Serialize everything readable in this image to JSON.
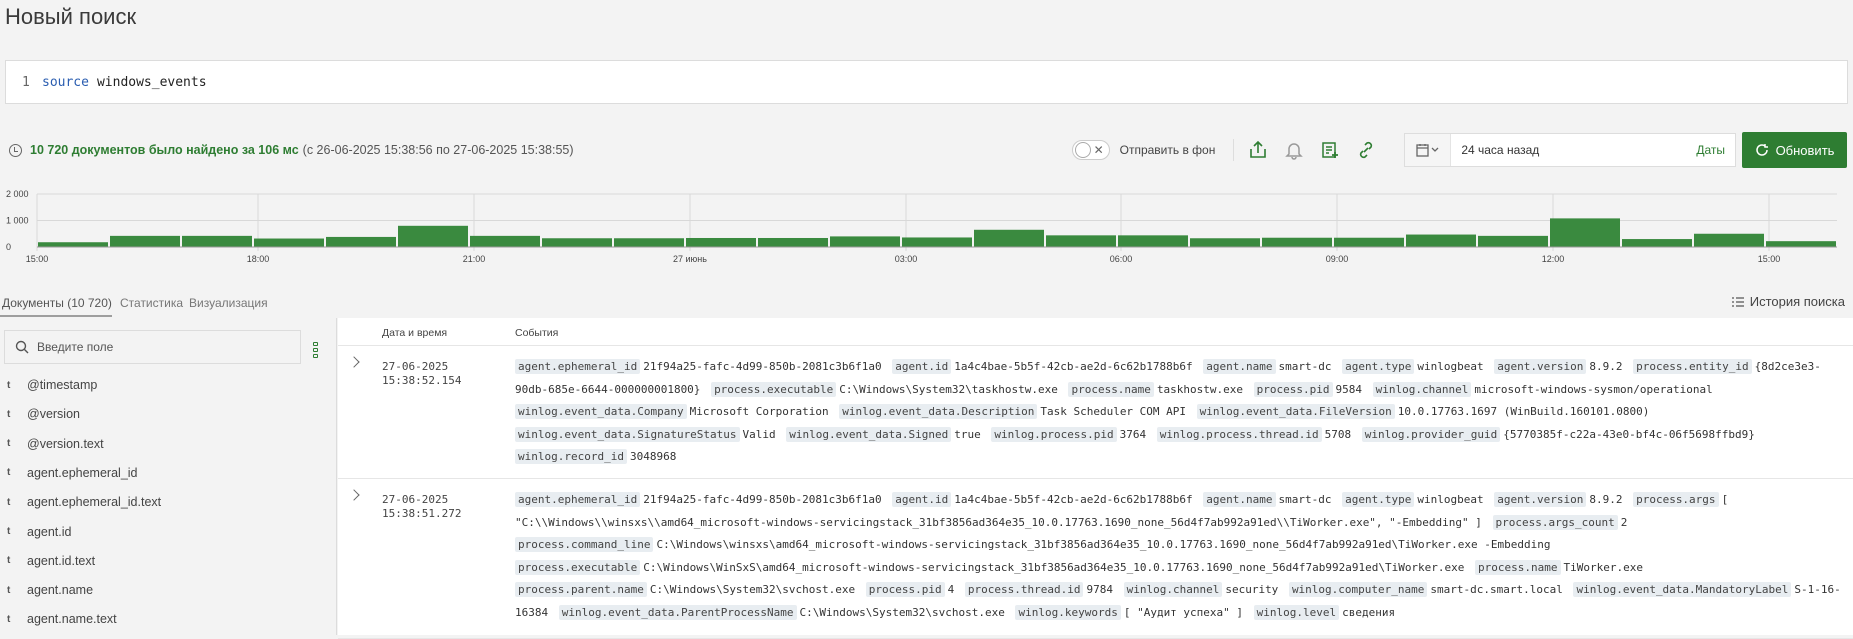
{
  "page_title": "Новый поиск",
  "editor": {
    "line": "1",
    "keyword": "source",
    "query": "windows_events"
  },
  "status": {
    "found": "10 720 документов было найдено за 106 мс",
    "range": "(с 26-06-2025 15:38:56 по 27-06-2025 15:38:55)"
  },
  "tools": {
    "background_label": "Отправить в фон",
    "toggle_x": "✕",
    "date_value": "24 часа назад",
    "dates_link": "Даты",
    "refresh_label": "Обновить"
  },
  "chart_data": {
    "type": "bar",
    "y_ticks": [
      "2 000",
      "1 000",
      "0"
    ],
    "ylim": [
      0,
      2000
    ],
    "x_ticks": [
      "15:00",
      "18:00",
      "21:00",
      "27 июнь",
      "03:00",
      "06:00",
      "09:00",
      "12:00",
      "15:00"
    ],
    "values": [
      180,
      420,
      420,
      320,
      380,
      800,
      420,
      330,
      330,
      340,
      340,
      400,
      360,
      650,
      440,
      440,
      330,
      350,
      350,
      470,
      420,
      1080,
      300,
      500,
      220
    ],
    "bar_color": "#3a8a3f",
    "grid": true
  },
  "tabs": {
    "documents": "Документы (10 720)",
    "stats": "Статистика",
    "viz": "Визуализация",
    "history": "История поиска"
  },
  "sidebar": {
    "search_placeholder": "Введите поле",
    "fields": [
      "@timestamp",
      "@version",
      "@version.text",
      "agent.ephemeral_id",
      "agent.ephemeral_id.text",
      "agent.id",
      "agent.id.text",
      "agent.name",
      "agent.name.text"
    ],
    "type_marker": "t"
  },
  "table": {
    "col_date": "Дата и время",
    "col_events": "События",
    "rows": [
      {
        "date": "27-06-2025",
        "time": "15:38:52.154",
        "pairs": [
          [
            "agent.ephemeral_id",
            "21f94a25-fafc-4d99-850b-2081c3b6f1a0"
          ],
          [
            "agent.id",
            "1a4c4bae-5b5f-42cb-ae2d-6c62b1788b6f"
          ],
          [
            "agent.name",
            "smart-dc"
          ],
          [
            "agent.type",
            "winlogbeat"
          ],
          [
            "agent.version",
            "8.9.2"
          ],
          [
            "process.entity_id",
            "{8d2ce3e3-90db-685e-6644-000000001800}"
          ],
          [
            "process.executable",
            "C:\\Windows\\System32\\taskhostw.exe"
          ],
          [
            "process.name",
            "taskhostw.exe"
          ],
          [
            "process.pid",
            "9584"
          ],
          [
            "winlog.channel",
            "microsoft-windows-sysmon/operational"
          ],
          [
            "winlog.event_data.Company",
            "Microsoft Corporation"
          ],
          [
            "winlog.event_data.Description",
            "Task Scheduler COM API"
          ],
          [
            "winlog.event_data.FileVersion",
            "10.0.17763.1697 (WinBuild.160101.0800)"
          ],
          [
            "winlog.event_data.SignatureStatus",
            "Valid"
          ],
          [
            "winlog.event_data.Signed",
            "true"
          ],
          [
            "winlog.process.pid",
            "3764"
          ],
          [
            "winlog.process.thread.id",
            "5708"
          ],
          [
            "winlog.provider_guid",
            "{5770385f-c22a-43e0-bf4c-06f5698ffbd9}"
          ],
          [
            "winlog.record_id",
            "3048968"
          ]
        ]
      },
      {
        "date": "27-06-2025",
        "time": "15:38:51.272",
        "pairs": [
          [
            "agent.ephemeral_id",
            "21f94a25-fafc-4d99-850b-2081c3b6f1a0"
          ],
          [
            "agent.id",
            "1a4c4bae-5b5f-42cb-ae2d-6c62b1788b6f"
          ],
          [
            "agent.name",
            "smart-dc"
          ],
          [
            "agent.type",
            "winlogbeat"
          ],
          [
            "agent.version",
            "8.9.2"
          ],
          [
            "process.args",
            "[ \"C:\\\\Windows\\\\winsxs\\\\amd64_microsoft-windows-servicingstack_31bf3856ad364e35_10.0.17763.1690_none_56d4f7ab992a91ed\\\\TiWorker.exe\", \"-Embedding\" ]"
          ],
          [
            "process.args_count",
            "2"
          ],
          [
            "process.command_line",
            "C:\\Windows\\winsxs\\amd64_microsoft-windows-servicingstack_31bf3856ad364e35_10.0.17763.1690_none_56d4f7ab992a91ed\\TiWorker.exe -Embedding"
          ],
          [
            "process.executable",
            "C:\\Windows\\WinSxS\\amd64_microsoft-windows-servicingstack_31bf3856ad364e35_10.0.17763.1690_none_56d4f7ab992a91ed\\TiWorker.exe"
          ],
          [
            "process.name",
            "TiWorker.exe"
          ],
          [
            "process.parent.name",
            "C:\\Windows\\System32\\svchost.exe"
          ],
          [
            "process.pid",
            "4"
          ],
          [
            "process.thread.id",
            "9784"
          ],
          [
            "winlog.channel",
            "security"
          ],
          [
            "winlog.computer_name",
            "smart-dc.smart.local"
          ],
          [
            "winlog.event_data.MandatoryLabel",
            "S-1-16-16384"
          ],
          [
            "winlog.event_data.ParentProcessName",
            "C:\\Windows\\System32\\svchost.exe"
          ],
          [
            "winlog.keywords",
            "[ \"Аудит успеха\" ]"
          ],
          [
            "winlog.level",
            "сведения"
          ]
        ]
      }
    ]
  }
}
